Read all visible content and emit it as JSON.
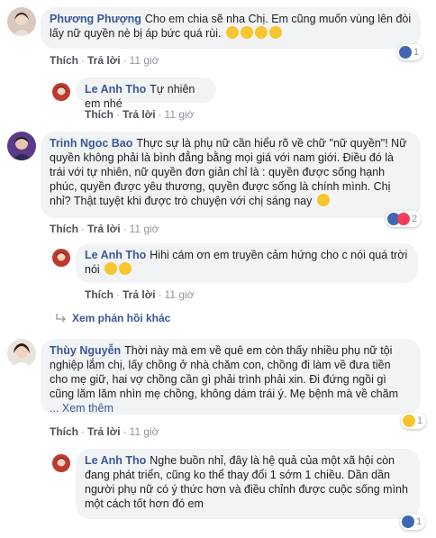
{
  "comments": [
    {
      "name": "Phương Phượng",
      "text": "Cho em chia sẽ nha Chị. Em cũng muốn vùng lên đòi lấy nữ quyền nè bị áp bức quá rùi.",
      "like": "Thích",
      "reply": "Trả lời",
      "time": "11 giờ",
      "reaction_count": "1"
    },
    {
      "name": "Le Anh Tho",
      "text": "Tự nhiên em nhé",
      "like": "Thích",
      "reply": "Trả lời",
      "time": "11 giờ"
    },
    {
      "name": "Trinh Ngoc Bao",
      "text": "Thực sự là phụ nữ cần hiểu rõ về chữ \"nữ quyền\"! Nữ quyền không phải là bình đẳng bằng mọi giá với nam giới. Điều đó là trái với tự nhiên, nữ quyền đơn giản chỉ là : quyền được sống hạnh phúc, quyền được yêu thương, quyền được sống là chính mình. Chị nhỉ? Thật tuyệt khi được trò chuyện với chị sáng nay",
      "like": "Thích",
      "reply": "Trả lời",
      "time": "11 giờ",
      "reaction_count": "2"
    },
    {
      "name": "Le Anh Tho",
      "text": "Hihi cám ơn em truyền cảm hứng cho c nói quá trời nói",
      "like": "Thích",
      "reply": "Trả lời",
      "time": "11 giờ"
    },
    {
      "name": "Thùy Nguyễn",
      "text": "Thời này mà em về quê em còn thấy nhiều phụ nữ tội nghiệp lắm chị, lấy chồng ở nhà chăm con, chồng đi làm về đưa tiền cho mẹ giữ, hai vợ chồng cần gì phải trình phải xin. Đi đứng ngồi gì cũng lăm lăm nhìn mẹ chồng, không dám trái ý. Mẹ bệnh mà về chăm",
      "see_more": "... Xem thêm",
      "like": "Thích",
      "reply": "Trả lời",
      "time": "11 giờ",
      "reaction_count": "1"
    },
    {
      "name": "Le Anh Tho",
      "text": "Nghe buồn nhỉ, đây là hệ quả của một xã hội còn đang phát triển, cũng ko thể thay đổi 1 sớm 1 chiều. Dần dần người phụ nữ có ý thức hơn và điều chỉnh được cuộc sống mình một cách tốt hơn đó em",
      "reaction_count": "1"
    }
  ],
  "more_replies": "Xem phản hồi khác",
  "separator": "·",
  "colors": {
    "bubble": "#f2f3f5",
    "name": "#385898",
    "like_blue": "#4267b2",
    "love_red": "#f33e58",
    "emoji_yellow": "#f7c52e"
  }
}
